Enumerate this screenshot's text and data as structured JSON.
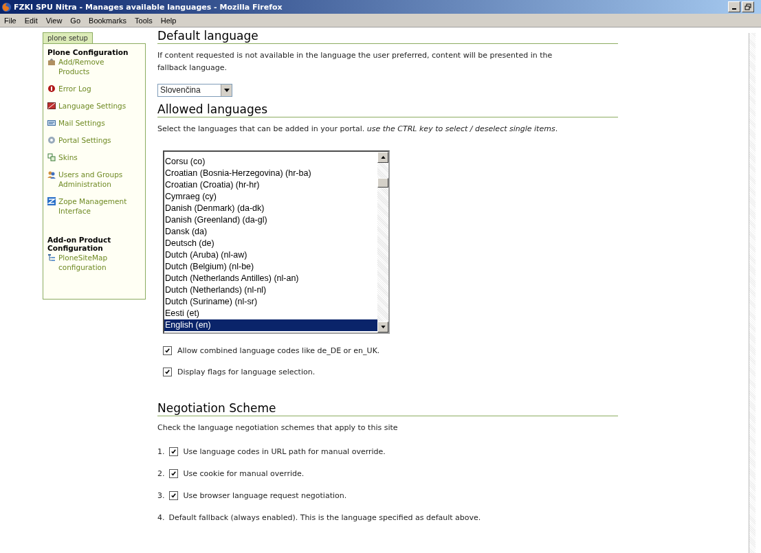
{
  "window": {
    "title": "FZKI SPU Nitra - Manages available languages - Mozilla Firefox"
  },
  "menu": [
    "File",
    "Edit",
    "View",
    "Go",
    "Bookmarks",
    "Tools",
    "Help"
  ],
  "sidebar": {
    "tab": "plone setup",
    "sections": [
      {
        "title": "Plone Configuration",
        "items": [
          {
            "label": "Add/Remove Products"
          },
          {
            "label": "Error Log"
          },
          {
            "label": "Language Settings"
          },
          {
            "label": "Mail Settings"
          },
          {
            "label": "Portal Settings"
          },
          {
            "label": "Skins"
          },
          {
            "label": "Users and Groups Administration"
          },
          {
            "label": "Zope Management Interface"
          }
        ]
      },
      {
        "title": "Add-on Product Configuration",
        "items": [
          {
            "label": "PloneSiteMap configuration"
          }
        ]
      }
    ]
  },
  "default_language": {
    "heading": "Default language",
    "description": "If content requested is not available in the language the user preferred, content will be presented in the fallback language.",
    "value": "Slovenčina"
  },
  "allowed_languages": {
    "heading": "Allowed languages",
    "description": "Select the languages that can be added in your portal. *use the CTRL key to select / deselect single items*.",
    "options": [
      {
        "label": "Corsu (co)",
        "selected": false
      },
      {
        "label": "Croatian (Bosnia-Herzegovina) (hr-ba)",
        "selected": false
      },
      {
        "label": "Croatian (Croatia) (hr-hr)",
        "selected": false
      },
      {
        "label": "Cymraeg (cy)",
        "selected": false
      },
      {
        "label": "Danish (Denmark) (da-dk)",
        "selected": false
      },
      {
        "label": "Danish (Greenland) (da-gl)",
        "selected": false
      },
      {
        "label": "Dansk (da)",
        "selected": false
      },
      {
        "label": "Deutsch (de)",
        "selected": false
      },
      {
        "label": "Dutch (Aruba) (nl-aw)",
        "selected": false
      },
      {
        "label": "Dutch (Belgium) (nl-be)",
        "selected": false
      },
      {
        "label": "Dutch (Netherlands Antilles) (nl-an)",
        "selected": false
      },
      {
        "label": "Dutch (Netherlands) (nl-nl)",
        "selected": false
      },
      {
        "label": "Dutch (Suriname) (nl-sr)",
        "selected": false
      },
      {
        "label": "Eesti (et)",
        "selected": false
      },
      {
        "label": "English (en)",
        "selected": true
      }
    ],
    "checkboxes": [
      {
        "label": "Allow combined language codes like de_DE or en_UK.",
        "checked": true
      },
      {
        "label": "Display flags for language selection.",
        "checked": true
      }
    ]
  },
  "negotiation": {
    "heading": "Negotiation Scheme",
    "description": "Check the language negotiation schemes that apply to this site",
    "items": [
      {
        "number": "1.",
        "label": "Use language codes in URL path for manual override.",
        "kind": "checkbox",
        "checked": true
      },
      {
        "number": "2.",
        "label": "Use cookie for manual override.",
        "kind": "checkbox",
        "checked": true
      },
      {
        "number": "3.",
        "label": "Use browser language request negotiation.",
        "kind": "checkbox",
        "checked": true
      },
      {
        "number": "4.",
        "label": "Default fallback (always enabled). This is the language specified as default above.",
        "kind": "text"
      }
    ]
  }
}
